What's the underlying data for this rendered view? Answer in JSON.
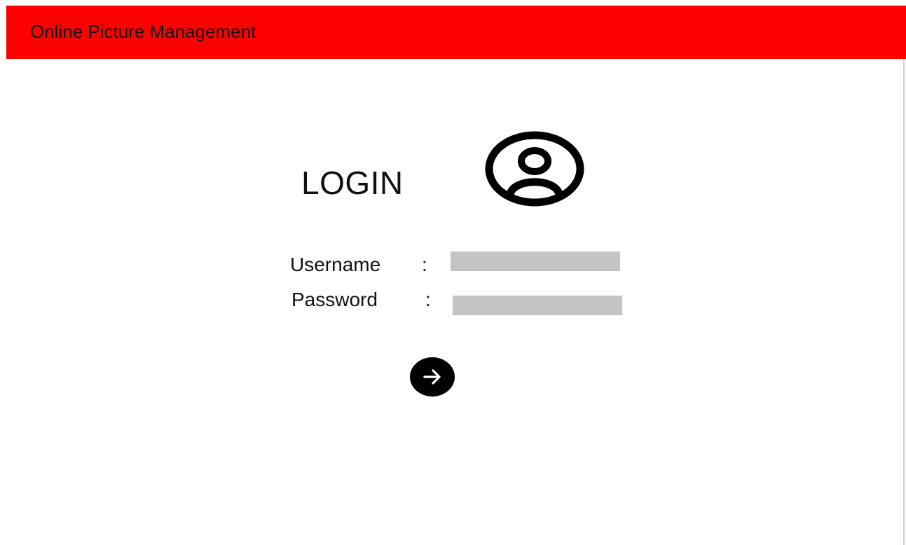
{
  "header": {
    "title": "Online Picture Management",
    "background_color": "#ff0000"
  },
  "login": {
    "title": "LOGIN",
    "avatar_icon": "user-circle-icon"
  },
  "form": {
    "username": {
      "label": "Username",
      "separator": ":",
      "value": "",
      "placeholder": ""
    },
    "password": {
      "label": "Password",
      "separator": ":",
      "value": "",
      "placeholder": ""
    },
    "submit_icon": "arrow-right-icon",
    "field_color": "#c4c4c4"
  }
}
